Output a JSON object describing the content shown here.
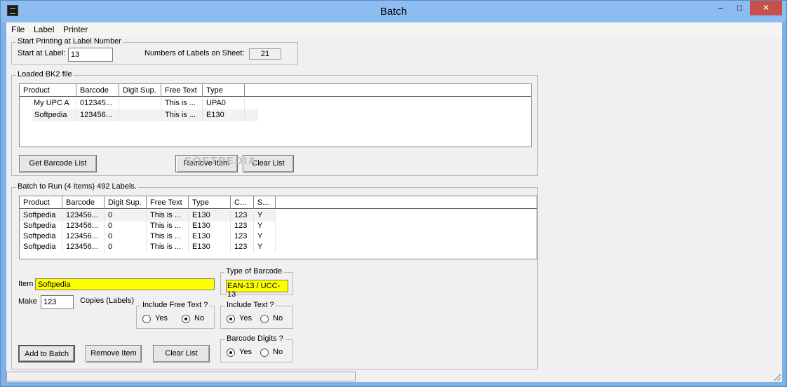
{
  "window": {
    "title": "Batch"
  },
  "window_controls": {
    "minimize": "–",
    "maximize": "□",
    "close": "✕"
  },
  "menu": [
    "File",
    "Label",
    "Printer"
  ],
  "start_printing": {
    "title": "Start Printing at Label Number",
    "start_label_text": "Start at Label:",
    "start_value": "13",
    "num_labels_text": "Numbers of Labels on Sheet:",
    "num_labels_value": "21"
  },
  "loaded": {
    "title": "Loaded BK2 file",
    "columns": [
      "Product",
      "Barcode",
      "Digit Sup.",
      "Free Text",
      "Type"
    ],
    "rows": [
      [
        "My UPC A",
        "012345...",
        "",
        "This is ...",
        "UPA0"
      ],
      [
        "Softpedia",
        "123456...",
        "",
        "This is ...",
        "E130"
      ]
    ],
    "get_list_button": "Get Barcode List",
    "remove_item_button": "Remove Item",
    "clear_list_button": "Clear List"
  },
  "batch": {
    "title": "Batch to Run   (4 Items) 492 Labels.",
    "columns": [
      "Product",
      "Barcode",
      "Digit Sup.",
      "Free Text",
      "Type",
      "C...",
      "S..."
    ],
    "rows": [
      [
        "Softpedia",
        "123456...",
        "0",
        "This is ...",
        "E130",
        "123",
        "Y"
      ],
      [
        "Softpedia",
        "123456...",
        "0",
        "This is ...",
        "E130",
        "123",
        "Y"
      ],
      [
        "Softpedia",
        "123456...",
        "0",
        "This is ...",
        "E130",
        "123",
        "Y"
      ],
      [
        "Softpedia",
        "123456...",
        "0",
        "This is ...",
        "E130",
        "123",
        "Y"
      ]
    ],
    "item_label": "Item",
    "item_value": "Softpedia",
    "make_label": "Make",
    "make_value": "123",
    "copies_label": "Copies (Labels)",
    "type_title": "Type of Barcode",
    "type_value": "EAN-13 / UCC-13",
    "free_text_title": "Include Free Text ?",
    "include_text_title": "Include Text ?",
    "digits_title": "Barcode Digits ?",
    "yes": "Yes",
    "no": "No",
    "add_button": "Add to Batch",
    "remove_button": "Remove Item",
    "clear_button": "Clear List"
  },
  "watermark": "SOFTPEDIA"
}
